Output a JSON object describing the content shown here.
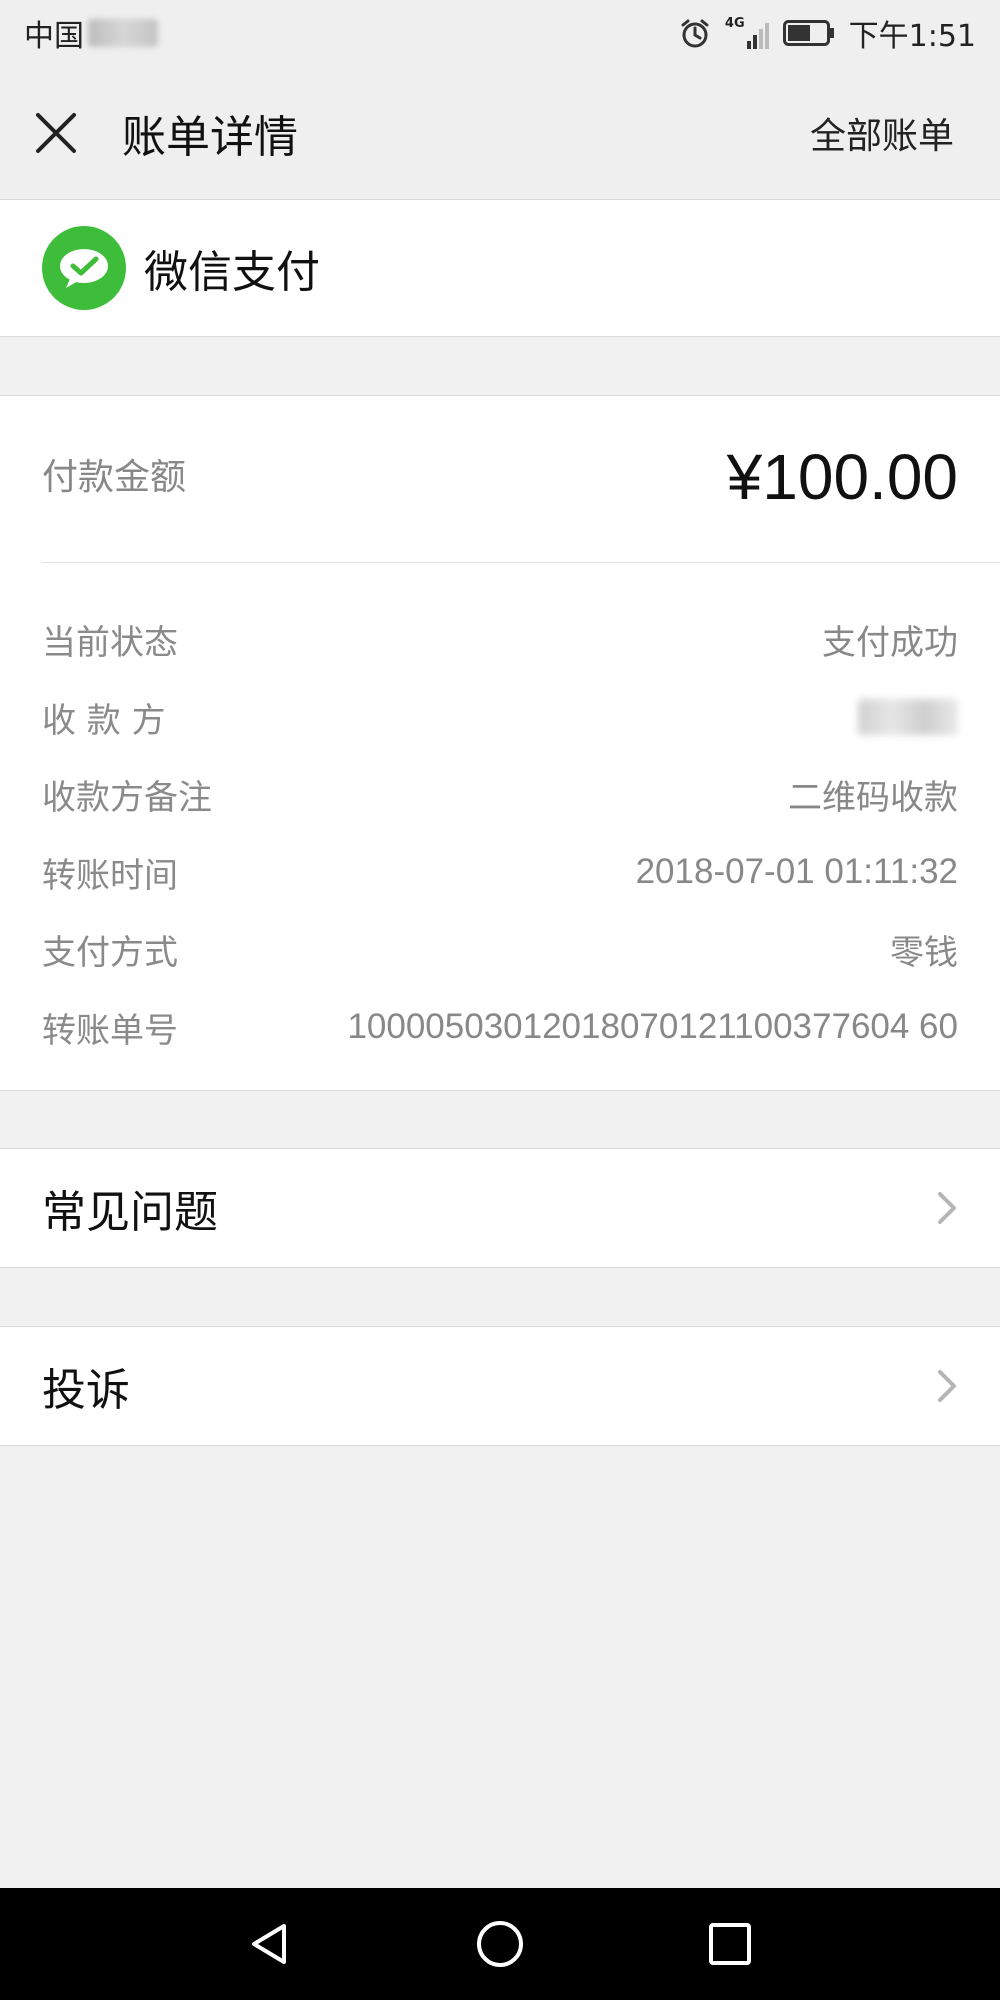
{
  "status_bar": {
    "carrier": "中国",
    "network": "4G",
    "time": "下午1:51"
  },
  "header": {
    "title": "账单详情",
    "all_bills_label": "全部账单"
  },
  "merchant": {
    "name": "微信支付"
  },
  "payment": {
    "amount_label": "付款金额",
    "amount_value": "¥100.00"
  },
  "details": [
    {
      "label": "当前状态",
      "value": "支付成功"
    },
    {
      "label": "收 款 方",
      "value": ""
    },
    {
      "label": "收款方备注",
      "value": "二维码收款"
    },
    {
      "label": "转账时间",
      "value": "2018-07-01 01:11:32"
    },
    {
      "label": "支付方式",
      "value": "零钱"
    },
    {
      "label": "转账单号",
      "value": "10000503012018070121100377604 60"
    }
  ],
  "menu": {
    "faq_label": "常见问题",
    "complaint_label": "投诉"
  },
  "icons": [
    "close-icon",
    "wechat-pay-icon",
    "chevron-right-icon",
    "alarm-icon",
    "signal-icon",
    "battery-icon",
    "back-icon",
    "home-icon",
    "recents-icon"
  ],
  "colors": {
    "brand_green": "#3dbd3a",
    "background": "#f1f1f1",
    "label_gray": "#8a8a8a"
  }
}
